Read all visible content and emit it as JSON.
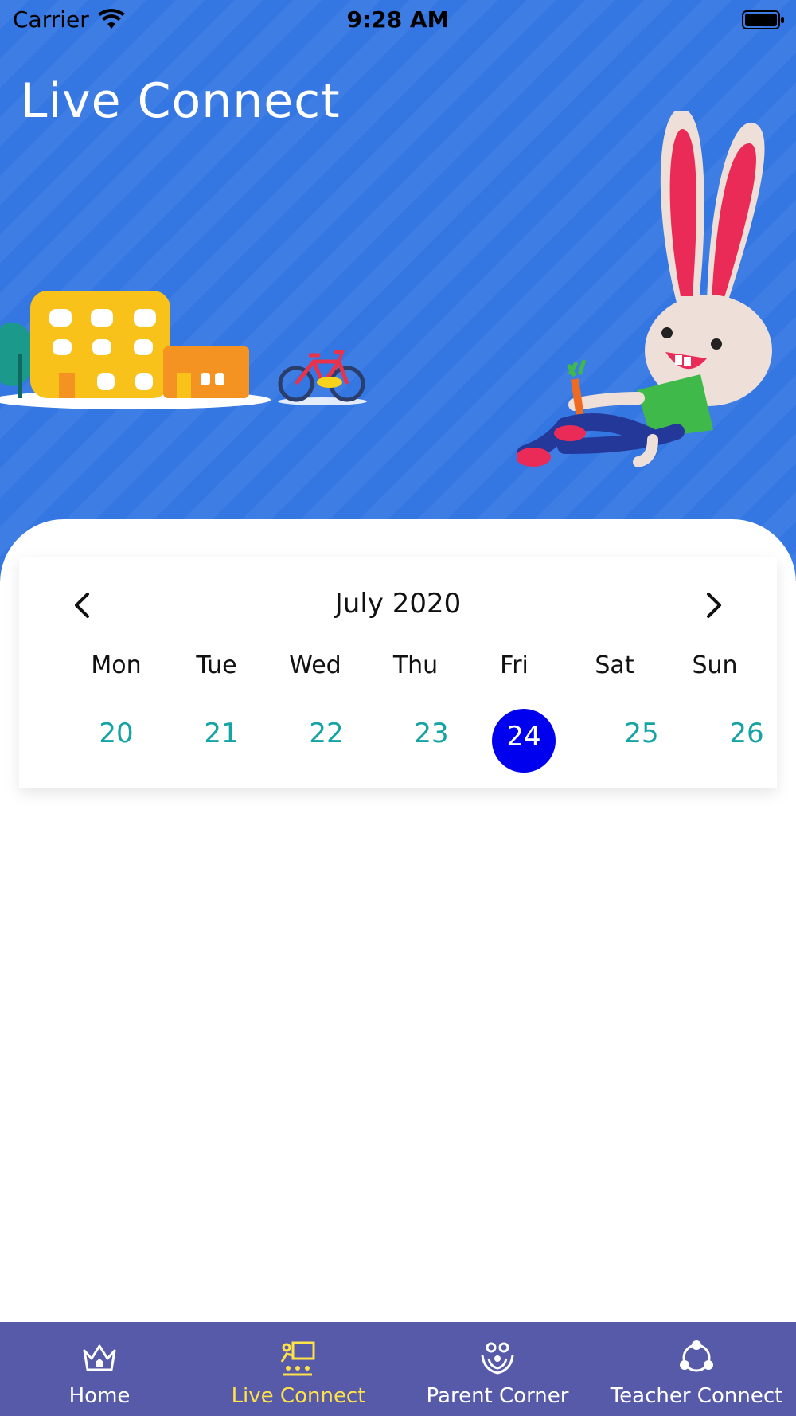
{
  "status_bar": {
    "carrier": "Carrier",
    "time": "9:28 AM"
  },
  "header": {
    "title": "Live Connect",
    "background_color": "#3476e2"
  },
  "calendar": {
    "month_label": "July 2020",
    "weekdays": [
      "Mon",
      "Tue",
      "Wed",
      "Thu",
      "Fri",
      "Sat",
      "Sun"
    ],
    "days": [
      "20",
      "21",
      "22",
      "23",
      "24",
      "25",
      "26"
    ],
    "selected_day": "24",
    "day_color": "#16a3a6",
    "selected_color": "#0000ee"
  },
  "tabbar": {
    "background_color": "#565aa8",
    "active_color": "#ffe14a",
    "items": [
      {
        "label": "Home",
        "icon": "crown-home-icon"
      },
      {
        "label": "Live Connect",
        "icon": "teacher-board-icon",
        "active": true
      },
      {
        "label": "Parent Corner",
        "icon": "family-hands-icon"
      },
      {
        "label": "Teacher Connect",
        "icon": "network-people-icon"
      }
    ]
  }
}
